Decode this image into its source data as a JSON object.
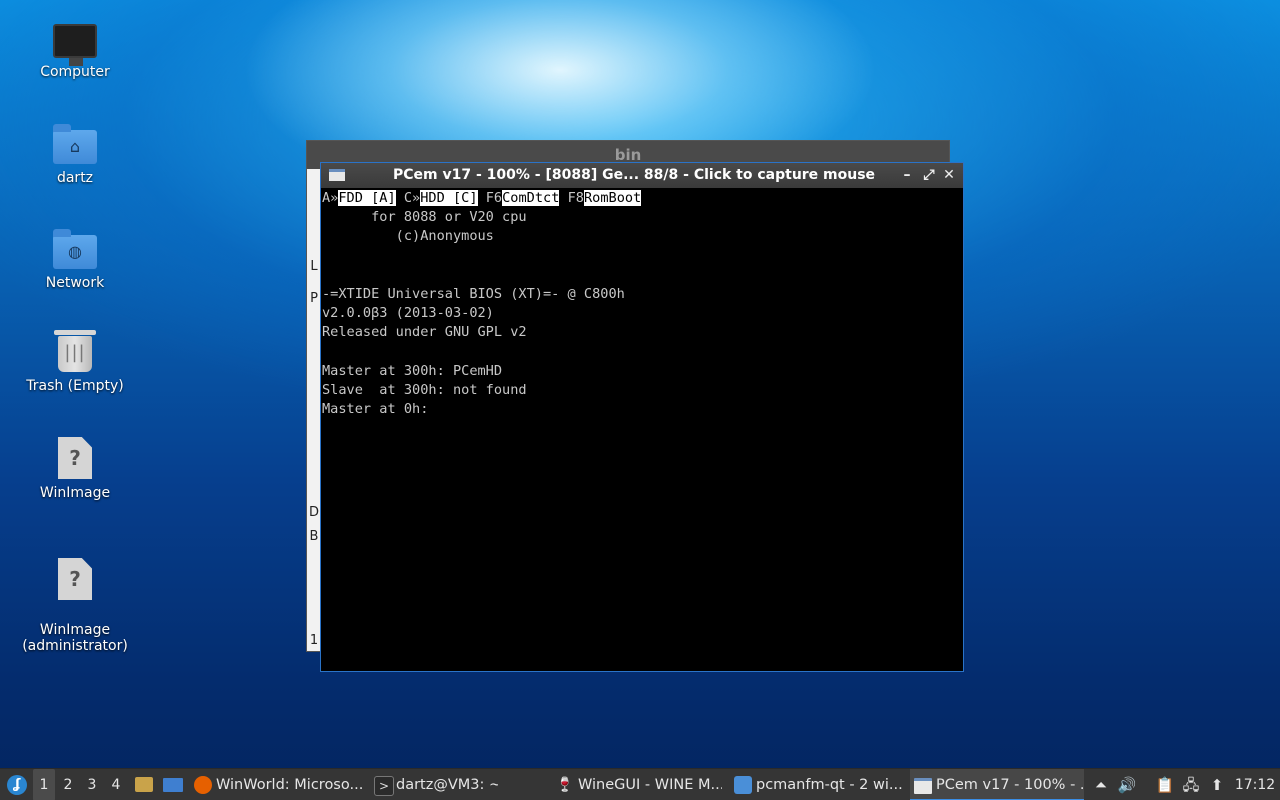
{
  "desktop": {
    "icons": [
      {
        "label": "Computer"
      },
      {
        "label": "dartz"
      },
      {
        "label": "Network"
      },
      {
        "label": "Trash (Empty)"
      },
      {
        "label": "WinImage"
      },
      {
        "label": "WinImage\n(administrator)"
      }
    ]
  },
  "bg_window": {
    "title": "bin",
    "side_letters": [
      "L",
      "P",
      "D",
      "B",
      "1"
    ]
  },
  "pcem": {
    "title": "PCem v17 - 100% - [8088] Ge... 88/8 - Click to capture mouse",
    "controls": {
      "minimize": "–",
      "maximize": "⤢",
      "close": "✕"
    },
    "screen": {
      "header": {
        "a_prefix": "A»",
        "a_label": "FDD [A]",
        "c_prefix": " C»",
        "c_label": "HDD [C]",
        "f6_prefix": " F6",
        "f6_label": "ComDtct",
        "f8_prefix": " F8",
        "f8_label": "RomBoot"
      },
      "lines": [
        "      for 8088 or V20 cpu",
        "         (c)Anonymous",
        "",
        "",
        "-=XTIDE Universal BIOS (XT)=- @ C800h",
        "v2.0.0β3 (2013-03-02)",
        "Released under GNU GPL v2",
        "",
        "Master at 300h: PCemHD",
        "Slave  at 300h: not found",
        "Master at 0h:"
      ]
    }
  },
  "taskbar": {
    "workspaces": [
      "1",
      "2",
      "3",
      "4"
    ],
    "tasks": [
      {
        "label": "WinWorld: Microso...",
        "icon": "firefox-icon"
      },
      {
        "label": "dartz@VM3: ~",
        "icon": "terminal-icon"
      },
      {
        "label": "WineGUI - WINE M...",
        "icon": "wine-icon"
      },
      {
        "label": "pcmanfm-qt - 2 wi...",
        "icon": "folder-icon"
      },
      {
        "label": "PCem v17 - 100% - ...",
        "icon": "window-icon"
      }
    ],
    "clock": "17:12"
  }
}
